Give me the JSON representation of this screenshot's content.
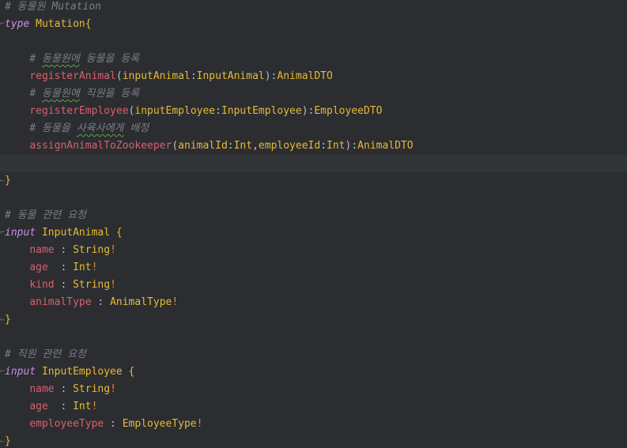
{
  "lines": [
    {
      "comment": "# 동물원 Mutation"
    },
    {
      "keyword": "type",
      "name": "Mutation",
      "brace": "{"
    },
    {},
    {
      "comment_prefix": "# ",
      "comment_squiggle": "동물원에",
      "comment_rest": " 동물을 등록"
    },
    {
      "method": "registerAnimal",
      "open": "(",
      "param": "inputAnimal",
      "colon": ":",
      "ptype": "InputAnimal",
      "close": "):",
      "rtype": "AnimalDTO"
    },
    {
      "comment_prefix": "# ",
      "comment_squiggle": "동물원에",
      "comment_rest": " 직원을 등록"
    },
    {
      "method": "registerEmployee",
      "open": "(",
      "param": "inputEmployee",
      "colon": ":",
      "ptype": "InputEmployee",
      "close": "):",
      "rtype": "EmployeeDTO"
    },
    {
      "comment_prefix": "# 동물을 ",
      "comment_squiggle": "사육사에게",
      "comment_rest": " 배정"
    },
    {
      "method": "assignAnimalToZookeeper",
      "open": "(",
      "p1": "animalId",
      "c1": ":",
      "t1": "Int",
      "comma": ",",
      "p2": "employeeId",
      "c2": ":",
      "t2": "Int",
      "close": "):",
      "rtype": "AnimalDTO"
    },
    {},
    {
      "brace": "}"
    },
    {},
    {
      "comment": "# 동물 관련 요청"
    },
    {
      "keyword": "input",
      "name": "InputAnimal",
      "brace": "{"
    },
    {
      "field": "name",
      "sep": " : ",
      "ftype": "String",
      "bang": "!"
    },
    {
      "field": "age",
      "sep": "  : ",
      "ftype": "Int",
      "bang": "!"
    },
    {
      "field": "kind",
      "sep": " : ",
      "ftype": "String",
      "bang": "!"
    },
    {
      "field": "animalType",
      "sep": " : ",
      "ftype": "AnimalType",
      "bang": "!"
    },
    {
      "brace": "}"
    },
    {},
    {
      "comment": "# 직원 관련 요청"
    },
    {
      "keyword": "input",
      "name": "InputEmployee",
      "brace": "{"
    },
    {
      "field": "name",
      "sep": " : ",
      "ftype": "String",
      "bang": "!"
    },
    {
      "field": "age",
      "sep": "  : ",
      "ftype": "Int",
      "bang": "!"
    },
    {
      "field": "employeeType",
      "sep": " : ",
      "ftype": "EmployeeType",
      "bang": "!"
    },
    {
      "brace": "}"
    }
  ],
  "colors": {
    "background": "#2b2d30",
    "current_line": "#313438",
    "comment": "#7a7e85",
    "keyword": "#cf8ee8",
    "type_name": "#e8ba36",
    "field_name": "#d9606d",
    "bang": "#e0884b",
    "text": "#bcbec4",
    "typo_underline": "#5fa24a"
  }
}
